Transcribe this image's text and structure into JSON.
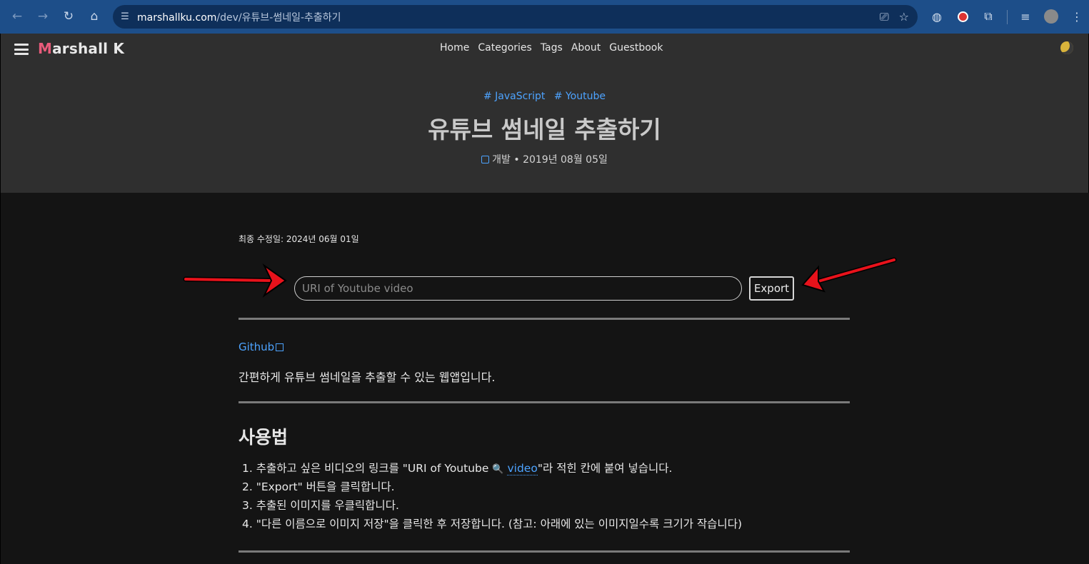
{
  "browser": {
    "url_host": "marshallku.com",
    "url_path": "/dev/유튜브-썸네일-추출하기"
  },
  "site": {
    "logo_initial": "M",
    "logo_rest": "arshall K",
    "nav": [
      "Home",
      "Categories",
      "Tags",
      "About",
      "Guestbook"
    ]
  },
  "post": {
    "tags": [
      "# JavaScript",
      "# Youtube"
    ],
    "title": "유튜브 썸네일 추출하기",
    "category": "개발",
    "bullet": "•",
    "date": "2019년 08월 05일",
    "modified": "최종 수정일: 2024년 06월 01일"
  },
  "app": {
    "input_placeholder": "URI of Youtube video",
    "export_label": "Export"
  },
  "content": {
    "github_link": "Github",
    "description": "간편하게 유튜브 썸네일을 추출할 수 있는 웹앱입니다.",
    "usage_heading": "사용법",
    "step1_pre": "1. 추출하고 싶은 비디오의 링크를 \"URI of Youtube ",
    "step1_link": "video",
    "step1_post": "\"라 적힌 칸에 붙여 넣습니다.",
    "step2": "2. \"Export\" 버튼을 클릭합니다.",
    "step3": "3. 추출된 이미지를 우클릭합니다.",
    "step4": "4. \"다른 이름으로 이미지 저장\"을 클릭한 후 저장합니다. (참고: 아래에 있는 이미지일수록 크기가 작습니다)"
  },
  "colors": {
    "link": "#4da3ff",
    "logo_accent": "#e85b7a",
    "annotation_arrow": "#e8121b"
  }
}
